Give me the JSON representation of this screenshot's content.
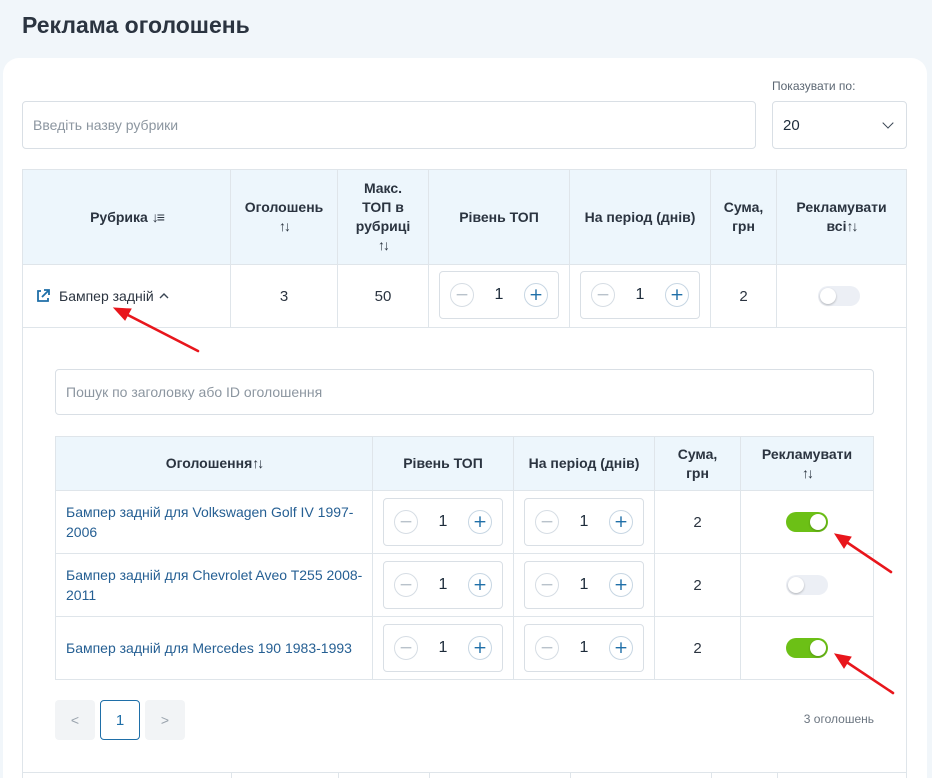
{
  "page": {
    "title": "Реклама оголошень"
  },
  "controls": {
    "search_placeholder": "Введіть назву рубрики",
    "per_page_label": "Показувати по:",
    "per_page_value": "20"
  },
  "main_table": {
    "headers": {
      "rubric": "Рубрика",
      "ads": "Оголошень",
      "max_top": "Макс. ТОП в рубриці",
      "level": "Рівень ТОП",
      "period": "На період (днів)",
      "sum": "Сума, грн",
      "advertise_all": "Рекламувати всі"
    },
    "row": {
      "rubric": "Бампер задній",
      "ads": "3",
      "max_top": "50",
      "level": "1",
      "period": "1",
      "sum": "2",
      "advertise_all": false
    }
  },
  "ads_panel": {
    "search_placeholder": "Пошук по заголовку або ID оголошення",
    "headers": {
      "ad": "Оголошення",
      "level": "Рівень ТОП",
      "period": "На період (днів)",
      "sum": "Сума, грн",
      "advertise": "Рекламувати"
    },
    "rows": [
      {
        "title": "Бампер задній для Volkswagen Golf IV 1997-2006",
        "level": "1",
        "period": "1",
        "sum": "2",
        "advertise": true
      },
      {
        "title": "Бампер задній для Chevrolet Aveo T255 2008-2011",
        "level": "1",
        "period": "1",
        "sum": "2",
        "advertise": false
      },
      {
        "title": "Бампер задній для Mercedes 190 1983-1993",
        "level": "1",
        "period": "1",
        "sum": "2",
        "advertise": true
      }
    ],
    "pagination": {
      "prev": "<",
      "current": "1",
      "next": ">"
    },
    "count_text": "3 оголошень"
  },
  "symbols": {
    "sort": "↑↓",
    "sort_alpha": "↓≡",
    "minus": "−",
    "plus": "+"
  },
  "colors": {
    "accent": "#1f6fa8",
    "toggle_on": "#6cc016",
    "annotation_arrow": "#e8161c"
  }
}
